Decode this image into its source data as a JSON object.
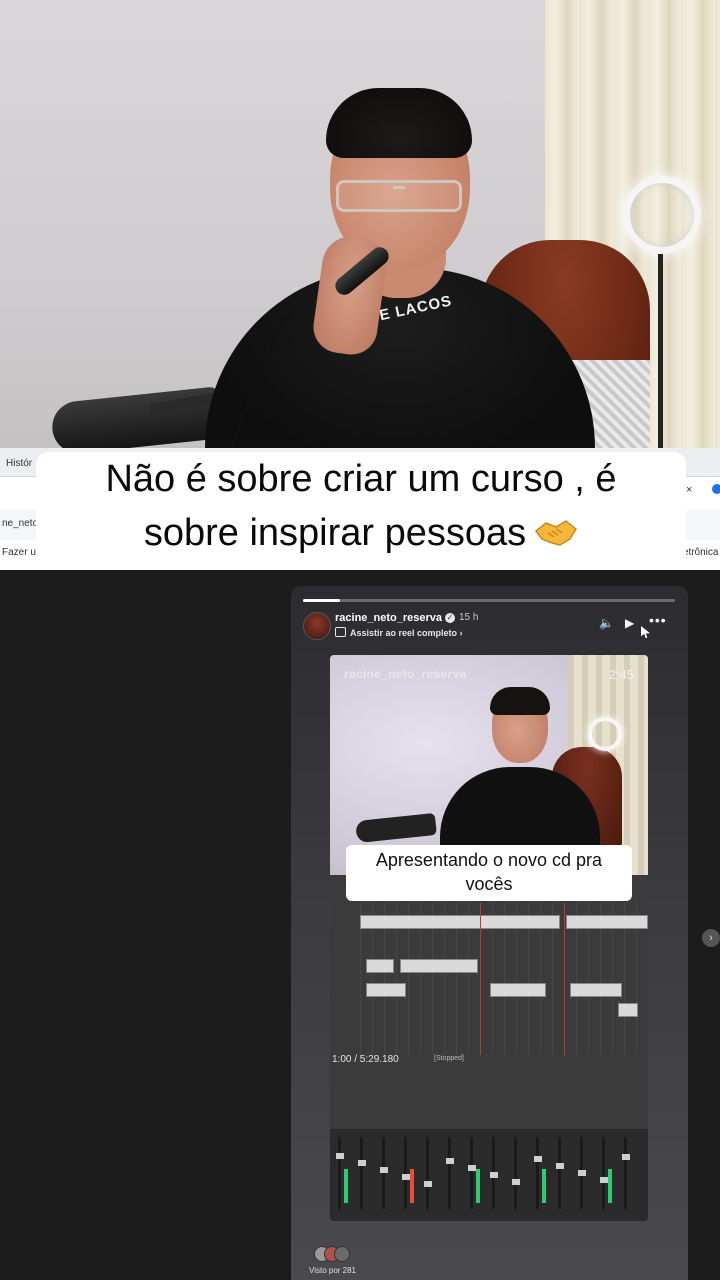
{
  "caption": {
    "line1": "Não é sobre criar um curso , é",
    "line2": "sobre inspirar pessoas"
  },
  "camera_scene": {
    "shirt_text": "STE LACOS"
  },
  "browser_strip": {
    "tab_fragment": "Histór",
    "tab_fragment_2": "ne_neto_reserv",
    "bookmark_fragment": "Fazer um C...",
    "bookmark_right": "Eletrônica",
    "close_label": "×"
  },
  "story": {
    "progress_fraction": 0.1,
    "username": "racine_neto_reserva",
    "verified_mark": "✓",
    "time_ago": "15 h",
    "watch_link": "Assistir ao reel completo",
    "controls": {
      "mute_icon": "🔈",
      "play_icon": "▶",
      "more_icon": "•••"
    },
    "inner_video": {
      "username": "racine_neto_reserva",
      "duration": "2:45",
      "caption_line1": "Apresentando o novo cd pra",
      "caption_line2": "vocês",
      "daw_time": "1:00 / 5:29.180",
      "daw_status": "[Stopped]"
    },
    "seen_by": "Visto por 281",
    "next_icon": "›"
  },
  "colors": {
    "background": "#1c1c1c",
    "story_card": "#3a3a3e",
    "caption_bg": "#ffffff",
    "caption_text": "#0a0a0a"
  }
}
